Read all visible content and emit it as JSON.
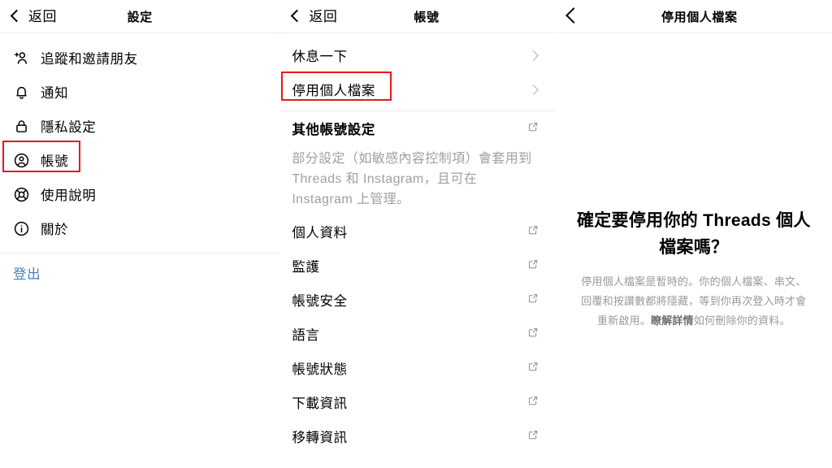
{
  "colors": {
    "highlight": "#e8191b",
    "link": "#4a7fc1",
    "muted": "#a0a0a0",
    "divider": "#efefef"
  },
  "settings_panel": {
    "header": {
      "back_label": "返回",
      "back_icon": "chevron-left-icon",
      "title": "設定"
    },
    "items": [
      {
        "label": "追蹤和邀請朋友",
        "icon": "person-add-icon"
      },
      {
        "label": "通知",
        "icon": "bell-icon"
      },
      {
        "label": "隱私設定",
        "icon": "lock-icon"
      },
      {
        "label": "帳號",
        "icon": "account-circle-icon",
        "highlighted": true
      },
      {
        "label": "使用說明",
        "icon": "life-ring-icon"
      },
      {
        "label": "關於",
        "icon": "info-circle-icon"
      }
    ],
    "logout_label": "登出"
  },
  "account_panel": {
    "header": {
      "back_label": "返回",
      "back_icon": "chevron-left-icon",
      "title": "帳號"
    },
    "items": [
      {
        "label": "休息一下",
        "accessory": "chevron-right-icon"
      },
      {
        "label": "停用個人檔案",
        "accessory": "chevron-right-icon",
        "highlighted": true
      }
    ],
    "section": {
      "title": "其他帳號設定",
      "accessory": "external-link-icon",
      "description": "部分設定（如敏感內容控制項）會套用到 Threads 和 Instagram，且可在 Instagram 上管理。"
    },
    "external_items": [
      {
        "label": "個人資料",
        "accessory": "external-link-icon"
      },
      {
        "label": "監護",
        "accessory": "external-link-icon"
      },
      {
        "label": "帳號安全",
        "accessory": "external-link-icon"
      },
      {
        "label": "語言",
        "accessory": "external-link-icon"
      },
      {
        "label": "帳號狀態",
        "accessory": "external-link-icon"
      },
      {
        "label": "下載資訊",
        "accessory": "external-link-icon"
      },
      {
        "label": "移轉資訊",
        "accessory": "external-link-icon"
      }
    ]
  },
  "deactivate_panel": {
    "header": {
      "back_icon": "chevron-left-icon",
      "title": "停用個人檔案"
    },
    "confirm_title": "確定要停用你的 Threads 個人檔案嗎？",
    "confirm_text_before": "停用個人檔案是暫時的。你的個人檔案、串文、回覆和按讚數都將隱藏，等到你再次登入時才會重新啟用。",
    "confirm_link": "瞭解詳情",
    "confirm_text_after": "如何刪除你的資料。"
  }
}
